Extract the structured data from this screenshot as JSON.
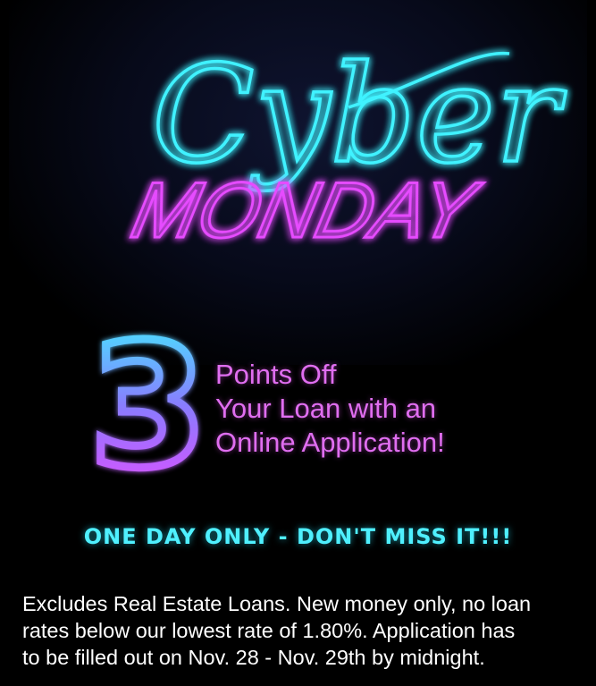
{
  "banner": {
    "headline_script": "Cyber",
    "headline_block": "MONDAY",
    "neon_cyan": "#3ff2ff",
    "neon_magenta": "#e64cff"
  },
  "promo": {
    "big_number": "3",
    "offer_lines": [
      "Points Off",
      "Your Loan with an",
      "Online Application!"
    ]
  },
  "callout": "ONE DAY ONLY - DON'T MISS IT!!!",
  "disclaimer_lines": [
    "Excludes Real Estate Loans. New money only, no loan",
    "rates below our lowest rate of 1.80%. Application has",
    "to be filled out on Nov. 28 - Nov. 29th by midnight."
  ]
}
